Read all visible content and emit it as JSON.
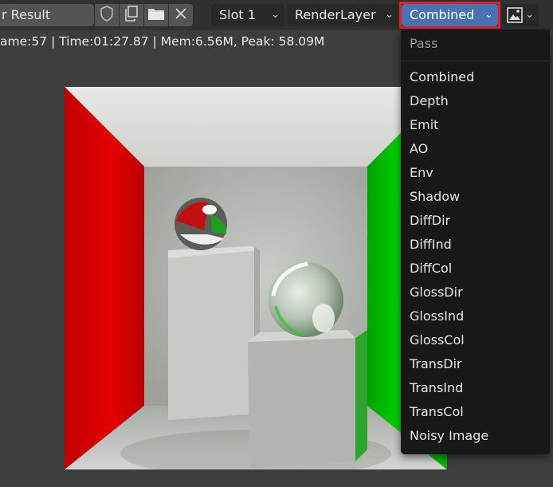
{
  "header": {
    "image_name": "r Result",
    "slot": "Slot 1",
    "layer": "RenderLayer",
    "pass": "Combined"
  },
  "icons": {
    "fake_user": "shield-icon",
    "duplicate": "duplicate-icon",
    "open": "folder-icon",
    "unlink": "close-icon",
    "display_mode": "image-icon",
    "zoom": "zoom-icon",
    "pan": "hand-icon"
  },
  "status": {
    "text": "ame:57 | Time:01:27.87 | Mem:6.56M, Peak: 58.09M"
  },
  "pass_menu": {
    "title": "Pass",
    "items": [
      "Combined",
      "Depth",
      "Emit",
      "AO",
      "Env",
      "Shadow",
      "DiffDir",
      "DiffInd",
      "DiffCol",
      "GlossDir",
      "GlossInd",
      "GlossCol",
      "TransDir",
      "TransInd",
      "TransCol",
      "Noisy Image"
    ]
  },
  "colors": {
    "accent": "#4772b3",
    "highlight": "#e0202b",
    "menu_bg": "#181818"
  }
}
